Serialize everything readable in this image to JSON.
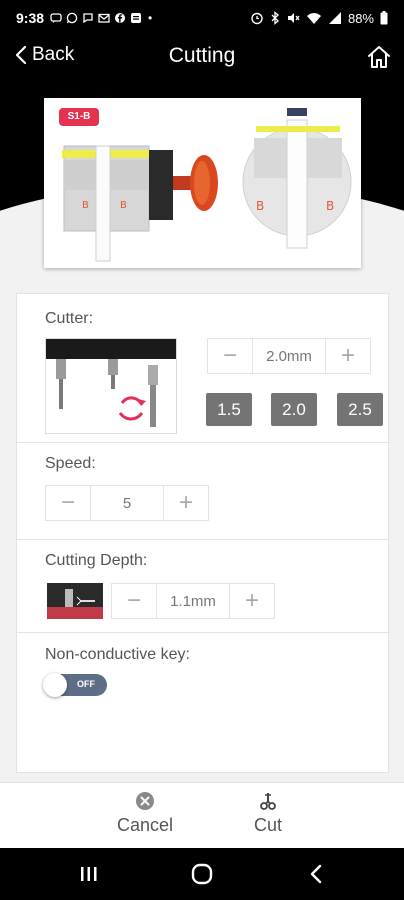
{
  "status_bar": {
    "time": "9:38",
    "notification_icons": [
      "message-icon",
      "whatsapp-icon",
      "chat-icon",
      "gmail-icon",
      "facebook-icon",
      "news-icon"
    ],
    "dot": "•",
    "battery": "88%"
  },
  "header": {
    "back_label": "Back",
    "title": "Cutting"
  },
  "image_card": {
    "badge": "S1-B"
  },
  "cutter": {
    "label": "Cutter:",
    "value": "2.0mm",
    "presets": [
      "1.5",
      "2.0",
      "2.5"
    ]
  },
  "speed": {
    "label": "Speed:",
    "value": "5"
  },
  "depth": {
    "label": "Cutting Depth:",
    "value": "1.1mm"
  },
  "non_conductive": {
    "label": "Non-conductive key:",
    "toggle_text": "OFF"
  },
  "actions": {
    "cancel": "Cancel",
    "cut": "Cut"
  },
  "colors": {
    "badge_red": "#e3334f",
    "preset_gray": "#747474",
    "toggle_blue": "#5e6e86"
  }
}
